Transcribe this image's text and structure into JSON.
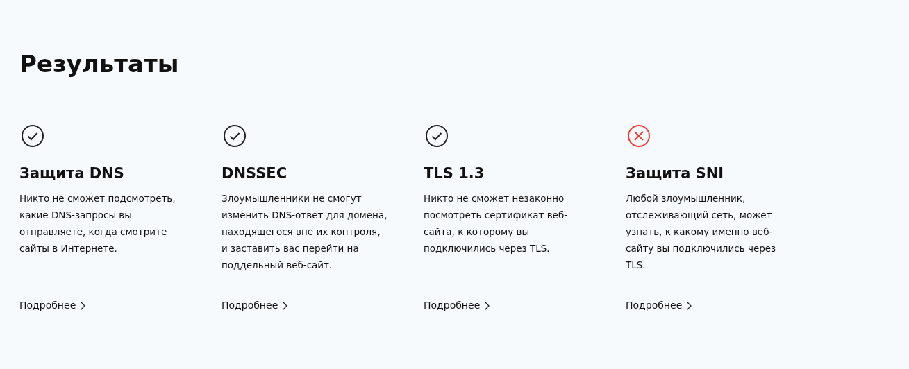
{
  "title": "Результаты",
  "results": [
    {
      "passed": true,
      "heading": "Защита DNS",
      "description": "Никто не сможет подсмотреть, какие DNS-запросы вы отправляете, когда смотрите сайты в Интернете.",
      "link": "Подробнее"
    },
    {
      "passed": true,
      "heading": "DNSSEC",
      "description": "Злоумышленники не смогут изменить DNS-ответ для домена, находящегося вне их контроля, и заставить вас перейти на поддельный веб-сайт.",
      "link": "Подробнее"
    },
    {
      "passed": true,
      "heading": "TLS 1.3",
      "description": "Никто не сможет незаконно посмотреть сертификат веб-сайта, к которому вы подключились через TLS.",
      "link": "Подробнее"
    },
    {
      "passed": false,
      "heading": "Защита SNI",
      "description": "Любой злоумышленник, отслеживающий сеть, может узнать, к какому именно веб-сайту вы подключились через TLS.",
      "link": "Подробнее"
    }
  ]
}
